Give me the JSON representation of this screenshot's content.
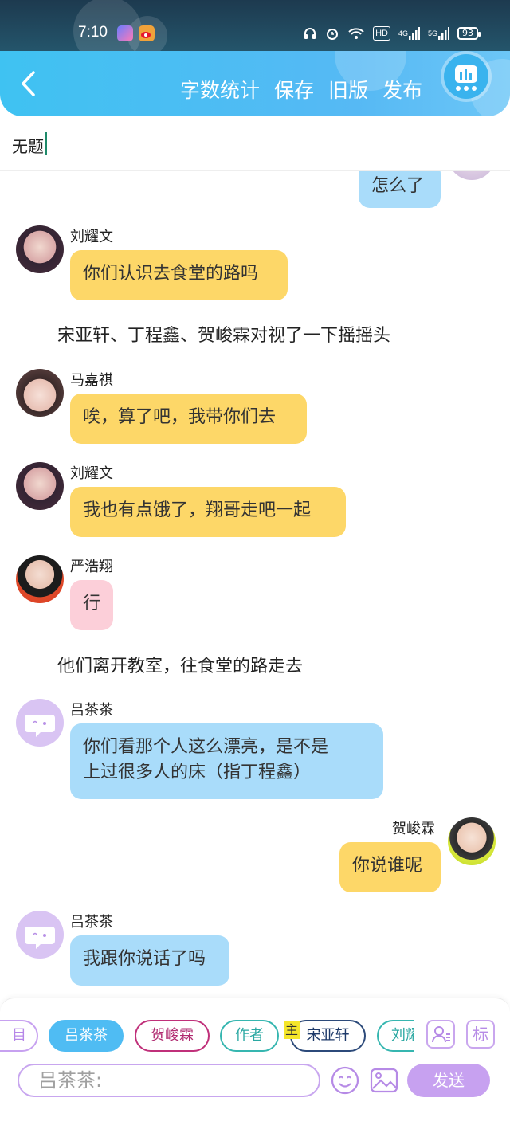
{
  "status_bar": {
    "time": "7:10",
    "network_hd": "HD",
    "network_4g": "4G",
    "network_5g": "5G",
    "battery": "93"
  },
  "header": {
    "actions": [
      "字数统计",
      "保存",
      "旧版",
      "发布"
    ]
  },
  "document": {
    "title": "无题"
  },
  "messages": [
    {
      "speaker": "",
      "text": "怎么了"
    },
    {
      "speaker": "刘耀文",
      "text": "你们认识去食堂的路吗"
    },
    {
      "narration": "宋亚轩、丁程鑫、贺峻霖对视了一下摇摇头"
    },
    {
      "speaker": "马嘉祺",
      "text": "唉，算了吧，我带你们去"
    },
    {
      "speaker": "刘耀文",
      "text": "我也有点饿了，翔哥走吧一起"
    },
    {
      "speaker": "严浩翔",
      "text": "行"
    },
    {
      "narration": "他们离开教室，往食堂的路走去"
    },
    {
      "speaker": "吕茶茶",
      "text_line1": "你们看那个人这么漂亮，是不是",
      "text_line2": "上过很多人的床（指丁程鑫）"
    },
    {
      "speaker": "贺峻霖",
      "text": "你说谁呢"
    },
    {
      "speaker": "吕茶茶",
      "text": "我跟你说话了吗"
    }
  ],
  "composer": {
    "chips": [
      "目",
      "吕茶茶",
      "贺峻霖",
      "作者",
      "宋亚轩",
      "刘耀"
    ],
    "main_badge": "主",
    "tool_icons": [
      "role-manage-icon",
      "tag-icon"
    ],
    "tag_label": "标",
    "input_value": "吕茶茶:",
    "send_label": "发送"
  },
  "colors": {
    "header_blue": "#4fbcf3",
    "bubble_yellow": "#fdd768",
    "bubble_blue": "#a9dcfa",
    "bubble_pink": "#fccfd9",
    "accent_purple": "#c7a1f0",
    "chip_active": "#4fbcf3"
  }
}
